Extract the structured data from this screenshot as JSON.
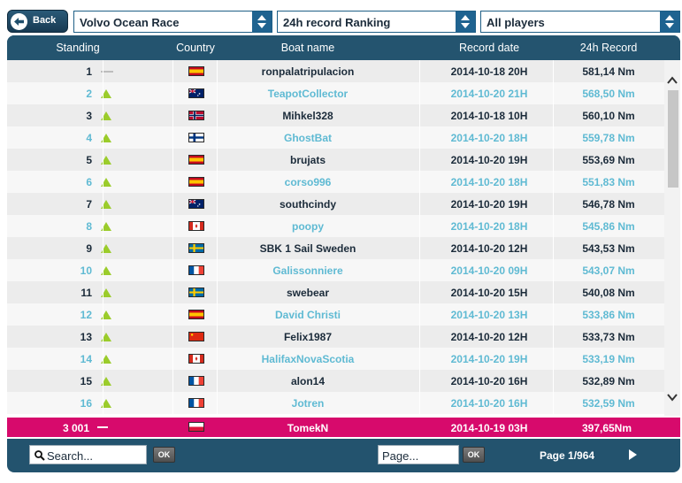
{
  "header": {
    "back_label": "Back",
    "race_select": "Volvo Ocean Race",
    "ranking_select": "24h record Ranking",
    "players_select": "All players"
  },
  "columns": {
    "standing": "Standing",
    "country": "Country",
    "boat": "Boat name",
    "date": "Record date",
    "record": "24h Record"
  },
  "rows": [
    {
      "rank": "1",
      "trend": "same",
      "flag": "spain",
      "name": "ronpalatripulacion",
      "date": "2014-10-18 20H",
      "record": "581,14 Nm"
    },
    {
      "rank": "2",
      "trend": "up",
      "flag": "australia",
      "name": "TeapotCollector",
      "date": "2014-10-20 21H",
      "record": "568,50 Nm"
    },
    {
      "rank": "3",
      "trend": "up",
      "flag": "norway",
      "name": "Mihkel328",
      "date": "2014-10-18 10H",
      "record": "560,10 Nm"
    },
    {
      "rank": "4",
      "trend": "up",
      "flag": "finland",
      "name": "GhostBat",
      "date": "2014-10-20 18H",
      "record": "559,78 Nm"
    },
    {
      "rank": "5",
      "trend": "up",
      "flag": "spain",
      "name": "brujats",
      "date": "2014-10-20 19H",
      "record": "553,69 Nm"
    },
    {
      "rank": "6",
      "trend": "up",
      "flag": "spain",
      "name": "corso996",
      "date": "2014-10-20 18H",
      "record": "551,83 Nm"
    },
    {
      "rank": "7",
      "trend": "up",
      "flag": "australia",
      "name": "southcindy",
      "date": "2014-10-20 19H",
      "record": "546,78 Nm"
    },
    {
      "rank": "8",
      "trend": "up",
      "flag": "canada",
      "name": "poopy",
      "date": "2014-10-20 18H",
      "record": "545,86 Nm"
    },
    {
      "rank": "9",
      "trend": "up",
      "flag": "sweden",
      "name": "SBK 1 Sail Sweden",
      "date": "2014-10-20 12H",
      "record": "543,53 Nm"
    },
    {
      "rank": "10",
      "trend": "up",
      "flag": "france",
      "name": "Galissonniere",
      "date": "2014-10-20 09H",
      "record": "543,07 Nm"
    },
    {
      "rank": "11",
      "trend": "up",
      "flag": "sweden",
      "name": "swebear",
      "date": "2014-10-20 15H",
      "record": "540,08 Nm"
    },
    {
      "rank": "12",
      "trend": "up",
      "flag": "spain",
      "name": "David Christi",
      "date": "2014-10-20 13H",
      "record": "533,86 Nm"
    },
    {
      "rank": "13",
      "trend": "up",
      "flag": "china",
      "name": "Felix1987",
      "date": "2014-10-20 12H",
      "record": "533,73 Nm"
    },
    {
      "rank": "14",
      "trend": "up",
      "flag": "canada",
      "name": "HalifaxNovaScotia",
      "date": "2014-10-20 19H",
      "record": "533,19 Nm"
    },
    {
      "rank": "15",
      "trend": "up",
      "flag": "france",
      "name": "alon14",
      "date": "2014-10-20 16H",
      "record": "532,89 Nm"
    },
    {
      "rank": "16",
      "trend": "up",
      "flag": "france",
      "name": "Jotren",
      "date": "2014-10-20 16H",
      "record": "532,59 Nm"
    }
  ],
  "my_row": {
    "rank": "3 001",
    "trend": "same",
    "flag": "poland",
    "name": "TomekN",
    "date": "2014-10-19 03H",
    "record": "397,65Nm"
  },
  "footer": {
    "search_placeholder": "Search...",
    "search_ok": "OK",
    "page_placeholder": "Page...",
    "page_ok": "OK",
    "page_info": "Page 1/964"
  },
  "colors": {
    "panel": "#23536e",
    "odd_row_text": "#1b2b3a",
    "even_row_text": "#5fbad3",
    "highlight_row": "#d70a6c",
    "trend_up": "#9bcc2b"
  }
}
